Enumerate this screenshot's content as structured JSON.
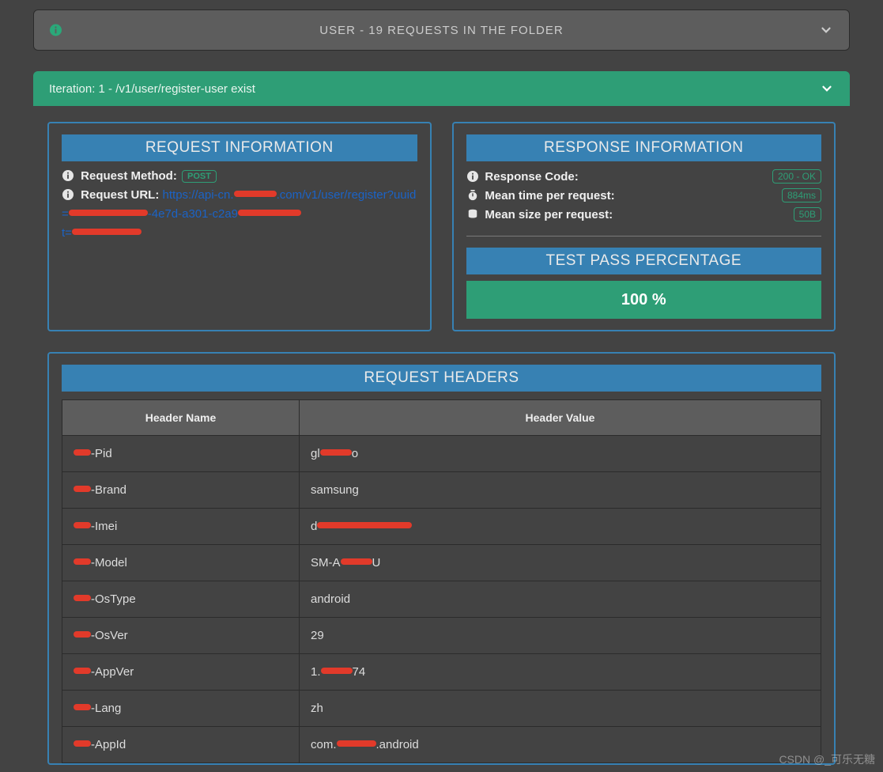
{
  "folder": {
    "title": "USER - 19 REQUESTS IN THE FOLDER"
  },
  "iteration": {
    "label": "Iteration: 1 - /v1/user/register-user exist"
  },
  "request_info": {
    "title": "REQUEST INFORMATION",
    "method_label": "Request Method:",
    "method_value": "POST",
    "url_label": "Request URL:",
    "url_pre": "https://api-cn.",
    "url_mid": ".com/v1/user/register?uuid=",
    "url_tail1": "-4e7d-a301-c2a9",
    "url_tail2": "t=",
    "url_redacted_host": "redacted",
    "url_redacted_uuid1": "redacted",
    "url_redacted_uuid2": "redacted",
    "url_redacted_t": "redacted"
  },
  "response_info": {
    "title": "RESPONSE INFORMATION",
    "code_label": "Response Code:",
    "code_value": "200 - OK",
    "time_label": "Mean time per request:",
    "time_value": "884ms",
    "size_label": "Mean size per request:",
    "size_value": "50B",
    "pass_title": "TEST PASS PERCENTAGE",
    "pass_value": "100 %"
  },
  "headers_section": {
    "title": "REQUEST HEADERS",
    "col_name": "Header Name",
    "col_value": "Header Value",
    "rows": [
      {
        "name_suffix": "-Pid",
        "value_pre": "gl",
        "value_post": "o"
      },
      {
        "name_suffix": "-Brand",
        "value_pre": "samsung",
        "value_post": ""
      },
      {
        "name_suffix": "-Imei",
        "value_pre": "d",
        "value_post": ""
      },
      {
        "name_suffix": "-Model",
        "value_pre": "SM-A",
        "value_post": "U"
      },
      {
        "name_suffix": "-OsType",
        "value_pre": "android",
        "value_post": ""
      },
      {
        "name_suffix": "-OsVer",
        "value_pre": "29",
        "value_post": ""
      },
      {
        "name_suffix": "-AppVer",
        "value_pre": "1.",
        "value_post": "74"
      },
      {
        "name_suffix": "-Lang",
        "value_pre": "zh",
        "value_post": ""
      },
      {
        "name_suffix": "-AppId",
        "value_pre": "com.",
        "value_post": ".android"
      }
    ],
    "redact_rows_value": [
      0,
      2,
      3,
      6,
      8
    ]
  },
  "watermark": "CSDN @_可乐无糖"
}
